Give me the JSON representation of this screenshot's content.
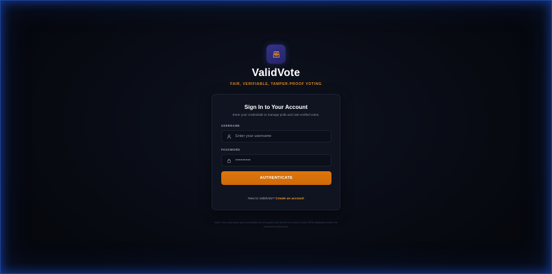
{
  "brand": {
    "name": "ValidVote",
    "tagline": "FAIR, VERIFIABLE, TAMPER-PROOF VOTING",
    "logo_icon": "ballot-box-icon",
    "accent_color": "#e08a1e"
  },
  "card": {
    "title": "Sign In to Your Account",
    "subtitle": "Enter your credentials to manage polls and cast verified votes.",
    "username": {
      "label": "USERNAME",
      "placeholder": "Enter your username",
      "value": "",
      "icon": "user-icon"
    },
    "password": {
      "label": "PASSWORD",
      "placeholder": "",
      "value": "•••••••••",
      "icon": "lock-icon"
    },
    "submit_label": "AUTHENTICATE",
    "button_color": "#d97008",
    "signup": {
      "prompt": "New to ValidVote?",
      "link_label": "Create an account"
    }
  },
  "note": "Note: Your username and credentials are encrypted and stored in a secure local JSON database inside the backend architecture.",
  "footer": ""
}
